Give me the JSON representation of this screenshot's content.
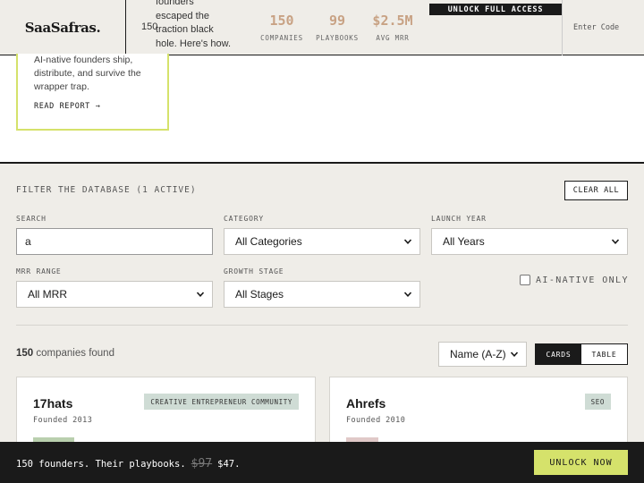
{
  "header": {
    "logo": "SaaSafras.",
    "count": "150",
    "tagline_lines": [
      "founders",
      "escaped the",
      "traction black",
      "hole. Here's how."
    ],
    "stats": [
      {
        "value": "150",
        "label": "COMPANIES"
      },
      {
        "value": "99",
        "label": "PLAYBOOKS"
      },
      {
        "value": "$2.5M",
        "label": "AVG MRR"
      }
    ],
    "unlock_label": "UNLOCK FULL ACCESS",
    "enter_code": "Enter Code"
  },
  "report": {
    "description": "AI-native founders ship, distribute, and survive the wrapper trap.",
    "link": "READ REPORT →"
  },
  "filters": {
    "title": "FILTER THE DATABASE (1 ACTIVE)",
    "clear_label": "CLEAR ALL",
    "search_label": "SEARCH",
    "search_value": "a",
    "category_label": "CATEGORY",
    "category_value": "All Categories",
    "year_label": "LAUNCH YEAR",
    "year_value": "All Years",
    "mrr_label": "MRR RANGE",
    "mrr_value": "All MRR",
    "stage_label": "GROWTH STAGE",
    "stage_value": "All Stages",
    "ai_label": "AI-NATIVE ONLY"
  },
  "results": {
    "count": "150",
    "count_suffix": " companies found",
    "sort_value": "Name (A-Z)",
    "view_cards": "CARDS",
    "view_table": "TABLE"
  },
  "cards": [
    {
      "name": "17hats",
      "founded": "Founded 2013",
      "tag": "CREATIVE ENTREPRENEUR COMMUNITY"
    },
    {
      "name": "Ahrefs",
      "founded": "Founded 2010",
      "tag": "SEO"
    }
  ],
  "bottom_bar": {
    "text": "150 founders. Their playbooks.",
    "old_price": "$97",
    "new_price": "$47.",
    "cta": "UNLOCK NOW"
  },
  "colors": {
    "accent": "#d5e26b",
    "stat": "#c8a284",
    "dark": "#1a1a1a",
    "tag": "#cfdcd5"
  }
}
